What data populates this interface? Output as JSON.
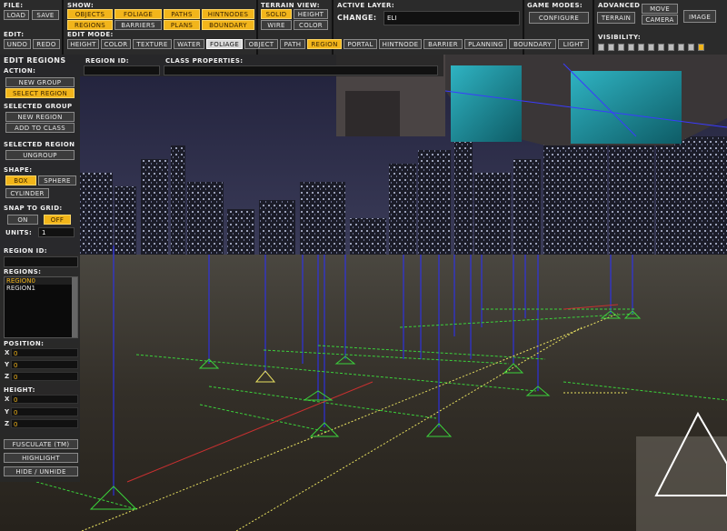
{
  "file": {
    "label": "FILE:",
    "load": "LOAD",
    "save": "SAVE"
  },
  "edit": {
    "label": "EDIT:",
    "undo": "UNDO",
    "redo": "REDO"
  },
  "show": {
    "label": "SHOW:",
    "row1": [
      "OBJECTS",
      "FOLIAGE",
      "PATHS",
      "HINTNODES"
    ],
    "row2": [
      "REGIONS",
      "BARRIERS",
      "PLANS",
      "BOUNDARY"
    ]
  },
  "terrain_view": {
    "label": "TERRAIN VIEW:",
    "solid": "SOLID",
    "height": "HEIGHT",
    "wire": "WIRE",
    "color": "COLOR"
  },
  "active_layer": {
    "label": "ACTIVE LAYER:",
    "change": "CHANGE:",
    "value": "ELI"
  },
  "game_modes": {
    "label": "GAME MODES:",
    "configure": "CONFIGURE"
  },
  "advanced": {
    "label": "ADVANCED",
    "terrain": "TERRAIN",
    "move": "MOVE",
    "camera": "CAMERA",
    "image": "IMAGE"
  },
  "edit_mode": {
    "label": "EDIT MODE:",
    "items": [
      "HEIGHT",
      "COLOR",
      "TEXTURE",
      "WATER",
      "FOLIAGE",
      "OBJECT",
      "PATH",
      "REGION",
      "PORTAL",
      "HINTNODE",
      "BARRIER",
      "PLANNING",
      "BOUNDARY",
      "LIGHT"
    ],
    "active": "REGION"
  },
  "visibility": {
    "label": "VISIBILITY:",
    "level": 10,
    "max": 10
  },
  "edit_regions": {
    "title": "EDIT REGIONS",
    "action_label": "ACTION:",
    "new_group": "NEW GROUP",
    "select_region": "SELECT REGION",
    "selected_group_label": "SELECTED GROUP",
    "new_region": "NEW REGION",
    "add_to_class": "ADD TO CLASS",
    "selected_region_label": "SELECTED REGION",
    "ungroup": "UNGROUP",
    "shape_label": "SHAPE:",
    "box": "BOX",
    "sphere": "SPHERE",
    "cylinder": "CYLINDER",
    "snap_label": "SNAP TO GRID:",
    "on": "ON",
    "off": "OFF",
    "units_label": "UNITS:",
    "units_value": "1",
    "region_id_label": "REGION ID:",
    "regions_label": "REGIONS:",
    "regions": [
      "REGION0",
      "REGION1"
    ],
    "selected_region": "REGION0",
    "position_label": "POSITION:",
    "position": {
      "x": "0",
      "y": "0",
      "z": "0"
    },
    "height_label": "HEIGHT:",
    "height": {
      "x": "0",
      "y": "0",
      "z": "0"
    },
    "fusculate": "FUSCULATE (TM)",
    "highlight": "HIGHLIGHT",
    "hide_unhide": "HIDE / UNHIDE"
  },
  "region_id_header": "REGION ID:",
  "class_properties_header": "CLASS PROPERTIES:",
  "axis_letters": {
    "x": "X",
    "y": "Y",
    "z": "Z"
  },
  "colors": {
    "accent": "#f2b51a",
    "panel": "#2b2b2b",
    "sky": "#2a2b45",
    "ground": "#3a352c",
    "region_line": "#2a2fff",
    "grid_green": "#3bd23b",
    "path_yellow": "#e8e060"
  },
  "icons": {
    "gizmo": "triangle-gizmo-icon",
    "marker": "region-marker-icon"
  }
}
